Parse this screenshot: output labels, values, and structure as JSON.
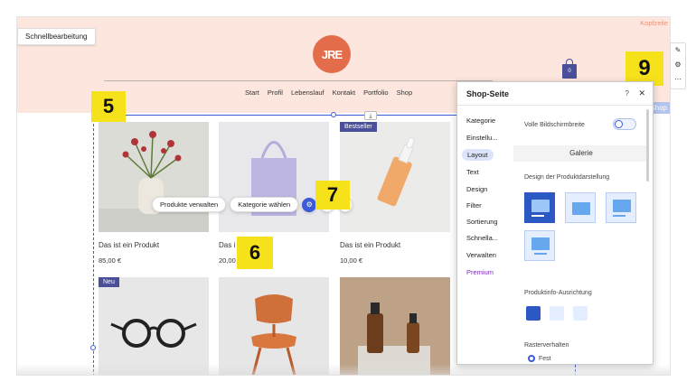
{
  "canvas": {
    "quick_edit": "Schnellbearbeitung",
    "header_tag": "Kopfzeile",
    "logo_text": "JRE",
    "cart_count": "0",
    "nav": [
      "Start",
      "Profil",
      "Lebenslauf",
      "Kontakt",
      "Portfolio",
      "Shop"
    ],
    "shop_tag": "Shop",
    "upload_glyph": "⤓"
  },
  "products": [
    {
      "name": "Das ist ein Produkt",
      "price": "85,00 €",
      "ribbon": ""
    },
    {
      "name": "Das i",
      "name_tail": "ukt",
      "price": "20,00",
      "ribbon": ""
    },
    {
      "name": "Das ist ein Produkt",
      "price": "10,00 €",
      "ribbon": "Bestseller"
    },
    {
      "name": "",
      "price": "",
      "ribbon": "Neu"
    },
    {
      "name": "",
      "price": "",
      "ribbon": ""
    },
    {
      "name": "",
      "price": "",
      "ribbon": ""
    }
  ],
  "toolbar": {
    "manage_products": "Produkte verwalten",
    "choose_category": "Kategorie wählen"
  },
  "badges": {
    "b5": "5",
    "b6": "6",
    "b7": "7",
    "b9": "9"
  },
  "panel": {
    "title": "Shop-Seite",
    "help": "?",
    "close": "✕",
    "tabs": [
      "Kategorie",
      "Einstellu...",
      "Layout",
      "Text",
      "Design",
      "Filter",
      "Sortierung",
      "Schnella...",
      "Verwalten",
      "Premium"
    ],
    "full_width_label": "Volle Bildschirmbreite",
    "gallery_label": "Galerie",
    "product_display_label": "Design der Produktdarstellung",
    "info_align_label": "Produktinfo-Ausrichtung",
    "grid_label": "Rasterverhalten",
    "grid_option": "Fest"
  },
  "right_tools": {
    "pen": "✎",
    "gear": "⚙",
    "more": "⋯"
  }
}
